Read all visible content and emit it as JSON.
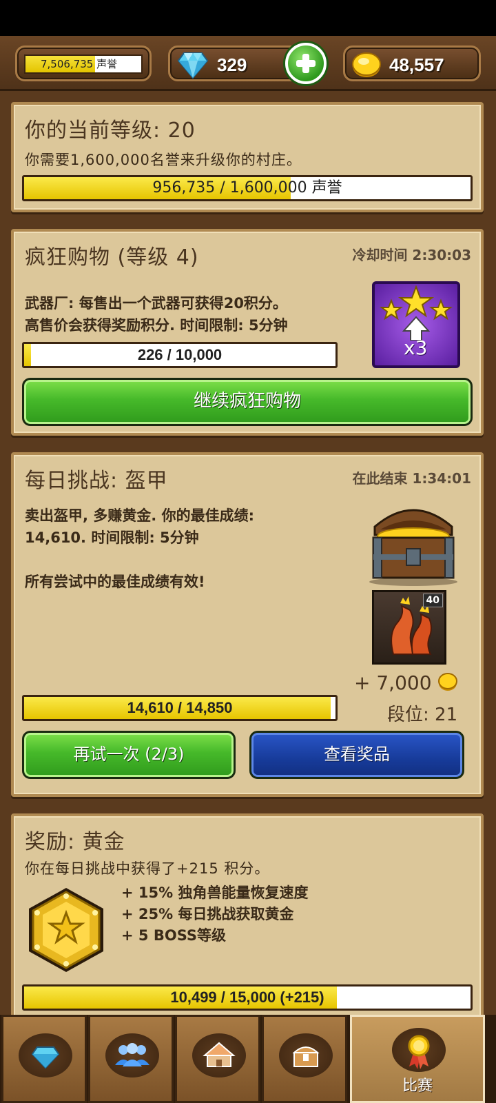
{
  "topbar": {
    "reputation": {
      "text": "7,506,735 声誉",
      "fill_fraction": 0.6
    },
    "gems": "329",
    "gold": "48,557"
  },
  "level_panel": {
    "title": "你的当前等级: 20",
    "desc": "你需要1,600,000名誉来升级你的村庄。",
    "progress": {
      "text": "956,735 / 1,600,000 声誉",
      "current": 956735,
      "max": 1600000
    }
  },
  "frenzy_panel": {
    "title": "疯狂购物 (等级 4)",
    "timer": "冷却时间 2:30:03",
    "desc": "武器厂: 每售出一个武器可获得20积分。\n高售价会获得奖励积分. 时间限制: 5分钟",
    "multiplier": "x3",
    "progress": {
      "text": "226 / 10,000",
      "current": 226,
      "max": 10000
    },
    "button": "继续疯狂购物"
  },
  "daily_panel": {
    "title": "每日挑战: 盔甲",
    "timer": "在此结束 1:34:01",
    "desc": "卖出盔甲, 多赚黄金. 你的最佳成绩:\n14,610. 时间限制: 5分钟\n\n所有尝试中的最佳成绩有效!",
    "reward_level": "40",
    "reward_gold": "+ 7,000",
    "rank": "段位: 21",
    "progress": {
      "text": "14,610 / 14,850",
      "current": 14610,
      "max": 14850
    },
    "retry_button": "再试一次 (2/3)",
    "view_button": "查看奖品"
  },
  "reward_panel": {
    "title": "奖励: 黄金",
    "desc": "你在每日挑战中获得了+215 积分。",
    "perks": [
      "+ 15% 独角兽能量恢复速度",
      "+ 25% 每日挑战获取黄金",
      "+ 5 BOSS等级"
    ],
    "progress": {
      "text": "10,499 / 15,000 (+215)",
      "current": 10499,
      "max": 15000
    }
  },
  "tabs": [
    {
      "icon": "gem-icon",
      "label": ""
    },
    {
      "icon": "people-icon",
      "label": ""
    },
    {
      "icon": "village-icon",
      "label": ""
    },
    {
      "icon": "chest-icon",
      "label": ""
    },
    {
      "icon": "medal-icon",
      "label": "比赛",
      "active": true
    }
  ],
  "colors": {
    "panel": "#dcc79a",
    "bar_fill": "#f0d400",
    "green_button": "#46b92a",
    "blue_button": "#173b9a"
  }
}
